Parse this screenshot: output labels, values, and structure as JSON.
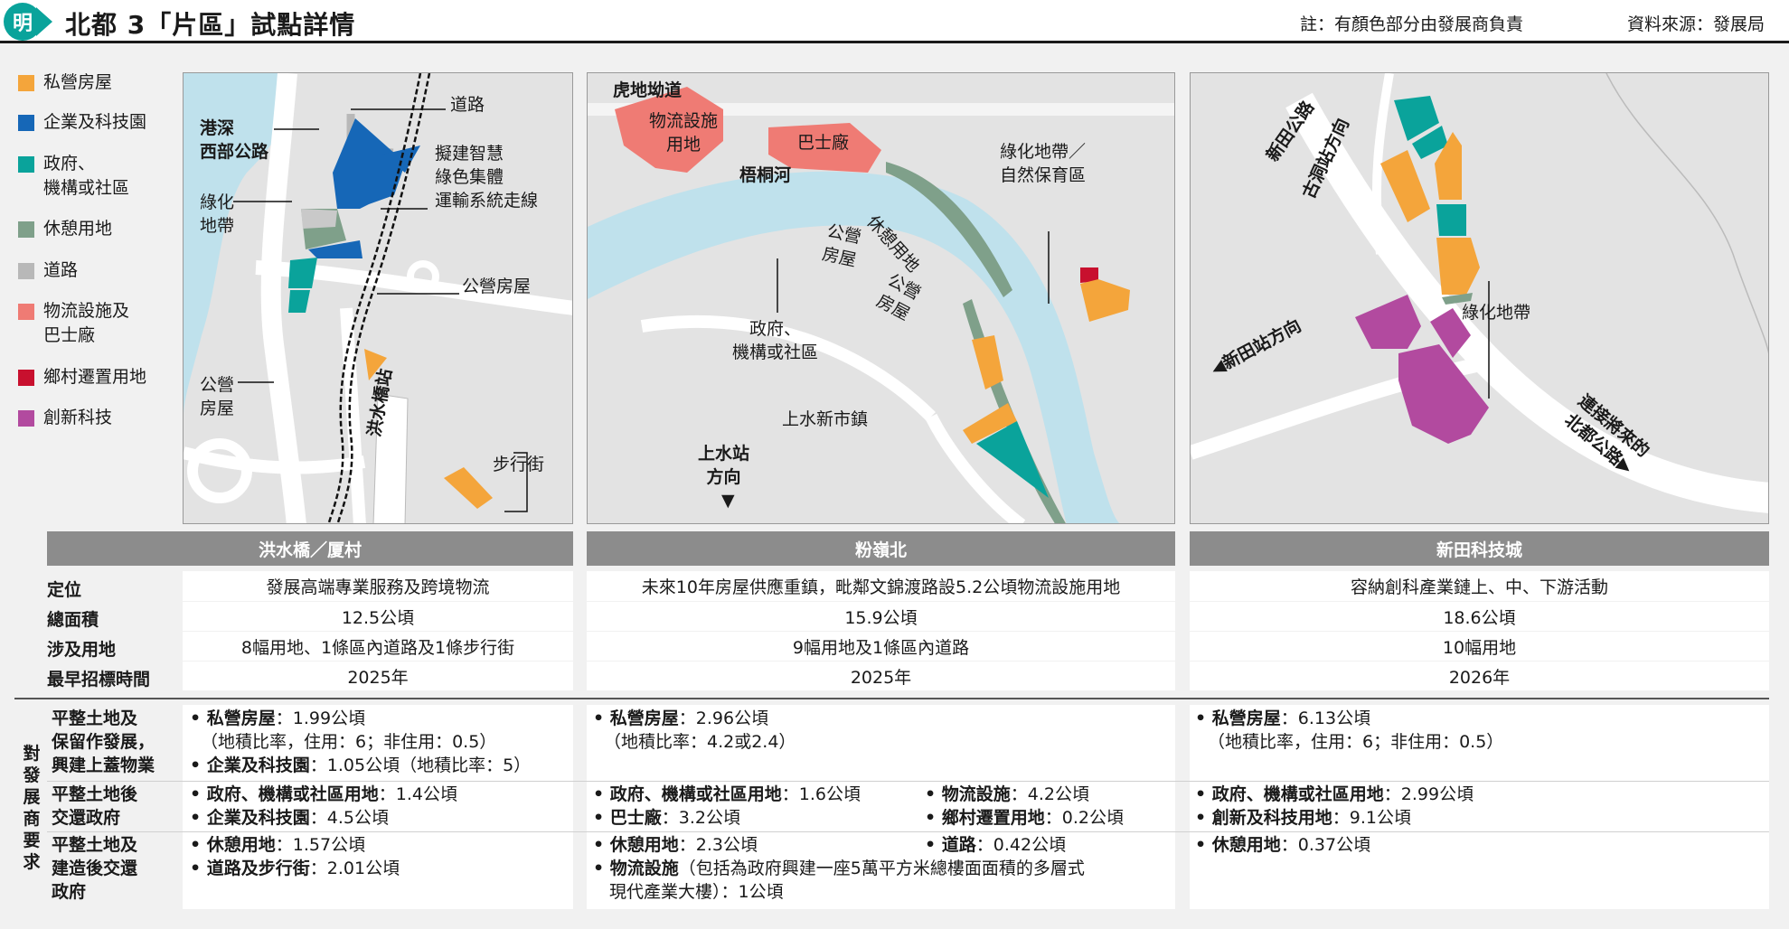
{
  "header": {
    "logo_char": "明",
    "title": "北都 3「片區」試點詳情",
    "note": "註：有顏色部分由發展商負責",
    "source": "資料來源：發展局"
  },
  "colors": {
    "private_housing": "#f4a53b",
    "enterprise_tech": "#1667b7",
    "gov_community": "#0aa39b",
    "leisure": "#7fa08a",
    "road": "#b8b8b8",
    "logistics": "#ef7b74",
    "rural_resite": "#c8102e",
    "innovation": "#b24a9f",
    "river": "#bfe1ec",
    "land": "#e3e3e3"
  },
  "legend": [
    {
      "label": "私營房屋",
      "color": "#f4a53b"
    },
    {
      "label": "企業及科技園",
      "color": "#1667b7"
    },
    {
      "label": "政府、\n機構或社區",
      "color": "#0aa39b"
    },
    {
      "label": "休憩用地",
      "color": "#7fa08a"
    },
    {
      "label": "道路",
      "color": "#b8b8b8"
    },
    {
      "label": "物流設施及\n巴士廠",
      "color": "#ef7b74"
    },
    {
      "label": "鄉村遷置用地",
      "color": "#c8102e"
    },
    {
      "label": "創新科技",
      "color": "#b24a9f"
    }
  ],
  "map1": {
    "l_road": "道路",
    "l_expressway": "港深\n西部公路",
    "l_smart_corridor": "擬建智慧\n綠色集體\n運輸系統走線",
    "l_green_belt": "綠化\n地帶",
    "l_public_housing_1": "公營房屋",
    "l_public_housing_2": "公營\n房屋",
    "l_station": "洪水橋站",
    "l_walkway": "步行街"
  },
  "map2": {
    "l_tiger_road": "虎地坳道",
    "l_logistics": "物流設施\n用地",
    "l_bus_depot": "巴士廠",
    "l_river": "梧桐河",
    "l_green_conservation": "綠化地帶／\n自然保育區",
    "l_leisure": "休憩用地",
    "l_public_housing_a": "公營\n房屋",
    "l_public_housing_b": "公營\n房屋",
    "l_gov": "政府、\n機構或社區",
    "l_town": "上水新市鎮",
    "l_station_dir": "上水站\n方向"
  },
  "map3": {
    "l_san_tin_road": "新田公路",
    "l_ku_tung_dir": "古洞站方向",
    "l_green_belt": "綠化地帶",
    "l_san_tin_dir": "◀新田站方向",
    "l_northern_link": "連接將來的\n北都公路▶"
  },
  "columns": [
    "洪水橋／厦村",
    "粉嶺北",
    "新田科技城"
  ],
  "info_rows": [
    {
      "label": "定位",
      "values": [
        "發展高端專業服務及跨境物流",
        "未來10年房屋供應重鎮，毗鄰文錦渡路設5.2公頃物流設施用地",
        "容納創科產業鏈上、中、下游活動"
      ]
    },
    {
      "label": "總面積",
      "values": [
        "12.5公頃",
        "15.9公頃",
        "18.6公頃"
      ]
    },
    {
      "label": "涉及用地",
      "values": [
        "8幅用地、1條區內道路及1條步行街",
        "9幅用地及1條區內道路",
        "10幅用地"
      ]
    },
    {
      "label": "最早招標時間",
      "values": [
        "2025年",
        "2025年",
        "2026年"
      ]
    }
  ],
  "requirements": {
    "side_label": "對\n發\n展\n商\n要\n求",
    "rows": [
      {
        "label": "平整土地及\n保留作發展，\n興建上蓋物業"
      },
      {
        "label": "平整土地後\n交還政府"
      },
      {
        "label": "平整土地及\n建造後交還\n政府"
      }
    ],
    "c1": {
      "r1_a_k": "私營房屋",
      "r1_a_v": "：1.99公頃",
      "r1_b": "（地積比率，住用：6；非住用：0.5）",
      "r1_c_k": "企業及科技園",
      "r1_c_v": "：1.05公頃（地積比率：5）",
      "r2_a_k": "政府、機構或社區用地",
      "r2_a_v": "：1.4公頃",
      "r2_b_k": "企業及科技園",
      "r2_b_v": "：4.5公頃",
      "r3_a_k": "休憩用地",
      "r3_a_v": "：1.57公頃",
      "r3_b_k": "道路及步行街",
      "r3_b_v": "：2.01公頃"
    },
    "c2": {
      "r1_a_k": "私營房屋",
      "r1_a_v": "：2.96公頃",
      "r1_b": "（地積比率：4.2或2.4）",
      "r2_a_k": "政府、機構或社區用地",
      "r2_a_v": "：1.6公頃",
      "r2_b_k": "物流設施",
      "r2_b_v": "：4.2公頃",
      "r2_c_k": "巴士廠",
      "r2_c_v": "：3.2公頃",
      "r2_d_k": "鄉村遷置用地",
      "r2_d_v": "：0.2公頃",
      "r3_a_k": "休憩用地",
      "r3_a_v": "：2.3公頃",
      "r3_b_k": "道路",
      "r3_b_v": "：0.42公頃",
      "r3_c_k": "物流設施",
      "r3_c_v": "（包括為政府興建一座5萬平方米總樓面面積的多層式",
      "r3_d": "現代產業大樓）：1公頃"
    },
    "c3": {
      "r1_a_k": "私營房屋",
      "r1_a_v": "：6.13公頃",
      "r1_b": "（地積比率，住用：6；非住用：0.5）",
      "r2_a_k": "政府、機構或社區用地",
      "r2_a_v": "：2.99公頃",
      "r2_b_k": "創新及科技用地",
      "r2_b_v": "：9.1公頃",
      "r3_a_k": "休憩用地",
      "r3_a_v": "：0.37公頃"
    }
  }
}
